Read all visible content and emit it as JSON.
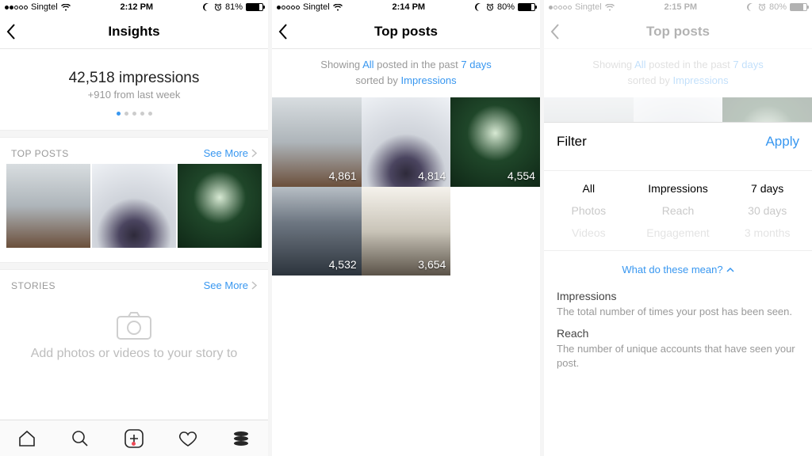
{
  "screen1": {
    "status": {
      "carrier": "Singtel",
      "time": "2:12 PM",
      "battery": "81%"
    },
    "title": "Insights",
    "impressions": "42,518 impressions",
    "impressions_delta": "+910 from last week",
    "top_posts_label": "TOP POSTS",
    "see_more": "See More",
    "stories_label": "STORIES",
    "stories_empty": "Add photos or videos to your story to"
  },
  "screen2": {
    "status": {
      "carrier": "Singtel",
      "time": "2:14 PM",
      "battery": "80%"
    },
    "title": "Top posts",
    "filter_prefix": "Showing",
    "filter_all": "All",
    "filter_mid": "posted in the past",
    "filter_period": "7 days",
    "filter_sort_prefix": "sorted by",
    "filter_sort": "Impressions",
    "posts": [
      {
        "count": "4,861"
      },
      {
        "count": "4,814"
      },
      {
        "count": "4,554"
      },
      {
        "count": "4,532"
      },
      {
        "count": "3,654"
      }
    ]
  },
  "screen3": {
    "status": {
      "carrier": "Singtel",
      "time": "2:15 PM",
      "battery": "80%"
    },
    "title": "Top posts",
    "filter_prefix": "Showing",
    "filter_all": "All",
    "filter_mid": "posted in the past",
    "filter_period": "7 days",
    "filter_sort_prefix": "sorted by",
    "filter_sort": "Impressions",
    "sheet": {
      "title": "Filter",
      "apply": "Apply",
      "col1": [
        "All",
        "Photos",
        "Videos"
      ],
      "col2": [
        "Impressions",
        "Reach",
        "Engagement"
      ],
      "col3": [
        "7 days",
        "30 days",
        "3 months"
      ],
      "help": "What do these mean?",
      "impressions_h": "Impressions",
      "impressions_d": "The total number of times your post has been seen.",
      "reach_h": "Reach",
      "reach_d": "The number of unique accounts that have seen your post."
    }
  }
}
